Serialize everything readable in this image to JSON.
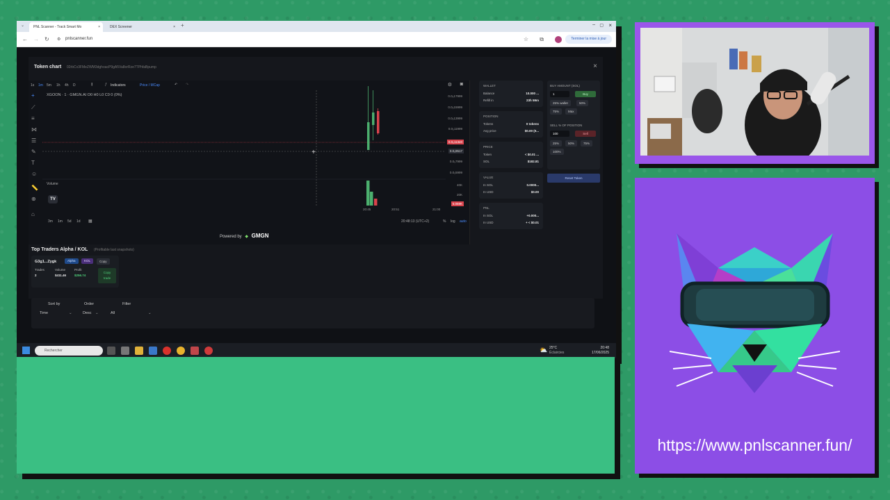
{
  "browser": {
    "tabs": [
      {
        "label": "PNL Scanner - Track Smart Mo",
        "active": true
      },
      {
        "label": "DEX Screener",
        "active": false
      }
    ],
    "url": "pnlscanner.fun",
    "update_button": "Terminer la mise à jour"
  },
  "modal": {
    "title": "Token chart",
    "address": "02rbCv3FMeZWM3dghoacP9gA5Va8orRze7TPhfaBpump",
    "close": "×"
  },
  "chart": {
    "timeframes": [
      "1s",
      "1m",
      "5m",
      "1h",
      "4h",
      "D"
    ],
    "active_timeframe": "1m",
    "indicators_label": "Indicators",
    "price_mcap_label": "Price / MCap",
    "symbol_line": "XGOON · 1 · GMGN.AI  O0 H0 L0 C0 0 (0%)",
    "volume_label": "Volume",
    "price_ticks": [
      "0.0₅17999",
      "0.0₅15999",
      "0.0₅13999",
      "0.0₅11999",
      "0.0₅7999",
      "0.0₅5999"
    ],
    "price_badge_red": "0.0₅113e0",
    "price_badge_grey": "0.0₅9517",
    "volume_ticks": [
      "40K",
      "20K"
    ],
    "volume_badge": "5.059K",
    "time_ticks": [
      "20:45",
      "20:51",
      "21:00"
    ],
    "ranges": [
      "3m",
      "1m",
      "5d",
      "1d"
    ],
    "clock": "20:48:13 (UTC+2)",
    "scale_opts": [
      "%",
      "log",
      "auto"
    ],
    "powered_by": "Powered by",
    "powered_brand": "GMGN"
  },
  "wallet": {
    "title": "WALLET",
    "balance_label": "Balance",
    "balance_value": "10.000 ...",
    "refill_label": "Refill in",
    "refill_value": "23h 59m"
  },
  "position": {
    "title": "POSITION",
    "tokens_label": "Tokens",
    "tokens_value": "0 tokens",
    "avg_label": "Avg price",
    "avg_value": "$0.00 (0..."
  },
  "price": {
    "title": "PRICE",
    "token_label": "Token",
    "token_value": "< $0.01 ...",
    "sol_label": "SOL",
    "sol_value": "$182.81"
  },
  "value": {
    "title": "VALUE",
    "sol_label": "In SOL",
    "sol_value": "0.0000...",
    "usd_label": "In USD",
    "usd_value": "$0.00"
  },
  "pnl": {
    "title": "PNL",
    "sol_label": "In SOL",
    "sol_value": "+0.000...",
    "usd_label": "In USD",
    "usd_value": "+ < $0.01"
  },
  "buy": {
    "title": "BUY AMOUNT (SOL)",
    "amount": "1",
    "buy_button": "Buy",
    "presets": [
      "25% wallet",
      "50%",
      "75%",
      "Max"
    ]
  },
  "sell": {
    "title": "SELL % OF POSITION",
    "amount": "100",
    "sell_button": "Sell",
    "presets": [
      "25%",
      "50%",
      "75%",
      "100%"
    ]
  },
  "reset_button": "Reset Token",
  "traders": {
    "title": "Top Traders Alpha / KOL",
    "subtitle": "(Profitable last snapshots)",
    "card": {
      "name": "G3g1...Zygk",
      "badge_alpha": "Alpha",
      "badge_kol": "KOL",
      "copy_label": "Copy",
      "trades_label": "Trades",
      "trades_value": "2",
      "volume_label": "Volume",
      "volume_value": "$411.46",
      "profit_label": "Profit",
      "profit_value": "$256.74",
      "copy_trade_label": "Copy trade"
    },
    "sort_label": "Sort by",
    "sort_value": "Time",
    "order_label": "Order",
    "order_value": "Desc",
    "filter_label": "Filter",
    "filter_value": "All"
  },
  "taskbar": {
    "search_placeholder": "Rechercher",
    "weather_temp": "25°C",
    "weather_desc": "Éclaircies",
    "time": "20:48",
    "date": "17/06/2025"
  },
  "overlay": {
    "site_url": "https://www.pnlscanner.fun/"
  },
  "colors": {
    "background_green": "#2e9a66",
    "panel_green": "#3abf83",
    "panel_purple": "#8c4ee6",
    "candle_up": "#4caf6e",
    "candle_down": "#d9434c",
    "accent_blue": "#4a8cff"
  }
}
